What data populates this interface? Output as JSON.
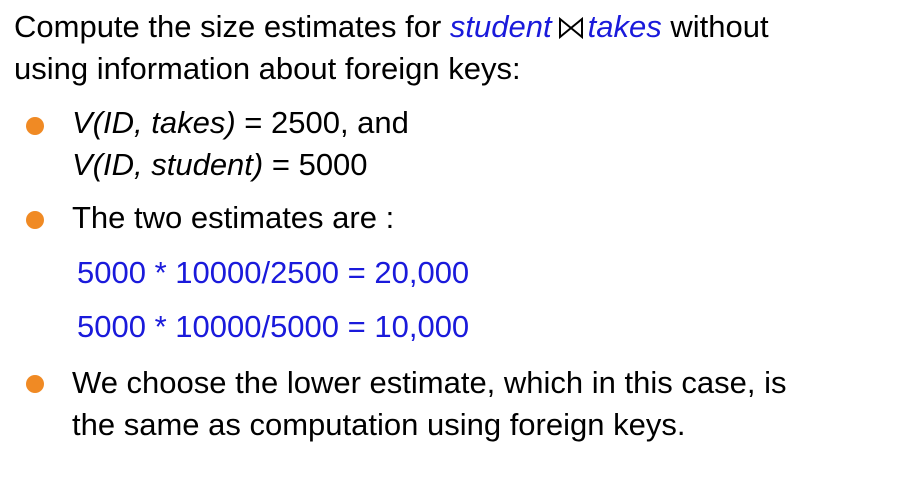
{
  "colors": {
    "text": "#000000",
    "highlight_blue": "#1a1adb",
    "highlight_orange": "#f07d10",
    "bullet": "#f08a24"
  },
  "intro": {
    "prefix": "Compute the size estimates for ",
    "rel1": "student",
    "join_icon": "natural-join-icon",
    "rel2": "takes",
    "suffix": " without",
    "line2": "using information about foreign keys:"
  },
  "bullets": [
    {
      "line1_italic": "V(ID, takes)",
      "line1_rest": " = 2500, and",
      "line2_italic": "V(ID, student)",
      "line2_rest": " = 5000"
    },
    {
      "text": "The two estimates are :"
    },
    {
      "line1": "We choose the lower estimate, which in this case, is",
      "line2": "the same as computation using foreign keys."
    }
  ],
  "formulas": [
    "5000 * 10000/2500 = 20,000",
    "5000 * 10000/5000 = 10,000"
  ]
}
